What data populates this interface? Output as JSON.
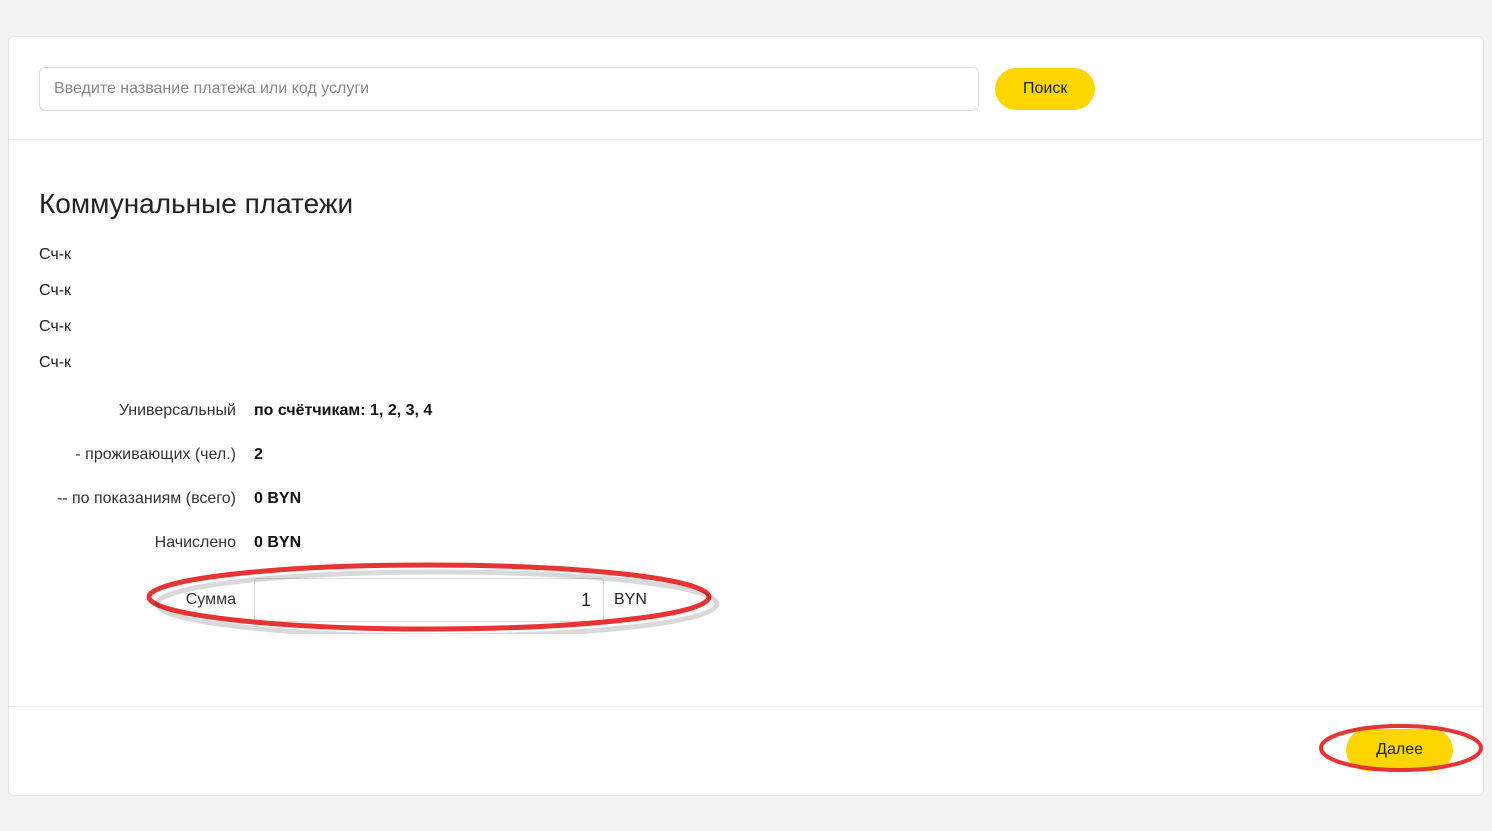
{
  "search": {
    "placeholder": "Введите название платежа или код услуги",
    "button": "Поиск"
  },
  "title": "Коммунальные платежи",
  "meters": {
    "line1": "Сч-к",
    "line2": "Сч-к",
    "line3": "Сч-к",
    "line4": "Сч-к"
  },
  "rows": {
    "universal": {
      "label": "Универсальный",
      "value": "по счётчикам: 1, 2, 3, 4"
    },
    "residents": {
      "label": "- проживающих (чел.)",
      "value": "2"
    },
    "readings": {
      "label": "-- по показаниям (всего)",
      "value": "0 BYN"
    },
    "accrued": {
      "label": "Начислено",
      "value": "0 BYN"
    },
    "amount": {
      "label": "Сумма",
      "value": "1",
      "currency": "BYN"
    }
  },
  "footer": {
    "next": "Далее"
  },
  "colors": {
    "accent": "#ffd600",
    "highlight": "#e63434"
  }
}
